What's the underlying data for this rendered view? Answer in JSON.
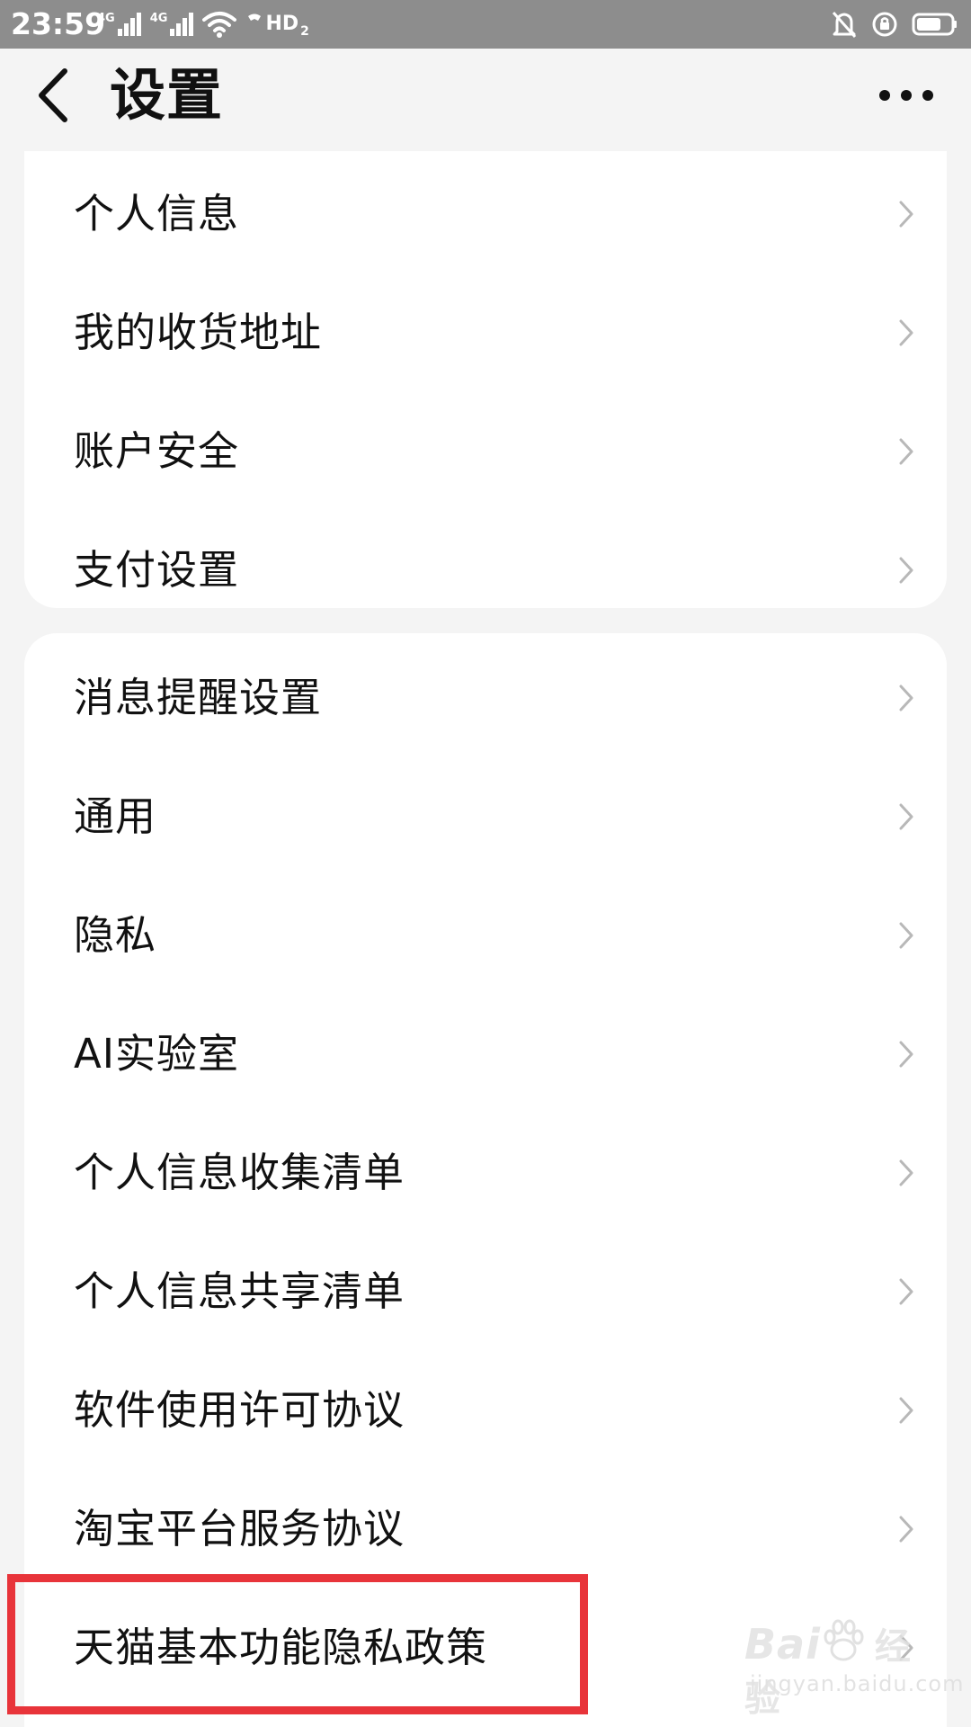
{
  "status_bar": {
    "time": "23:59",
    "network_1": "4G",
    "network_2": "4G",
    "hd_label": "HD",
    "hd_sub": "2"
  },
  "header": {
    "title": "设置",
    "back_icon": "chevron-left-icon",
    "more_icon": "more-dots-icon"
  },
  "group1": {
    "items": [
      {
        "label": "个人信息"
      },
      {
        "label": "我的收货地址"
      },
      {
        "label": "账户安全"
      },
      {
        "label": "支付设置"
      }
    ]
  },
  "group2": {
    "items": [
      {
        "label": "消息提醒设置"
      },
      {
        "label": "通用"
      },
      {
        "label": "隐私"
      },
      {
        "label": "AI实验室"
      },
      {
        "label": "个人信息收集清单"
      },
      {
        "label": "个人信息共享清单"
      },
      {
        "label": "软件使用许可协议"
      },
      {
        "label": "淘宝平台服务协议"
      },
      {
        "label": "天猫基本功能隐私政策"
      }
    ]
  },
  "watermark": {
    "brand_left": "Bai",
    "brand_right": "经验",
    "url": "jingyan.baidu.com"
  },
  "colors": {
    "highlight": "#e8343a",
    "status_bar": "#8d8d8d",
    "background": "#f4f4f4",
    "card": "#ffffff",
    "text": "#111111",
    "chevron": "#b8b8b8"
  }
}
